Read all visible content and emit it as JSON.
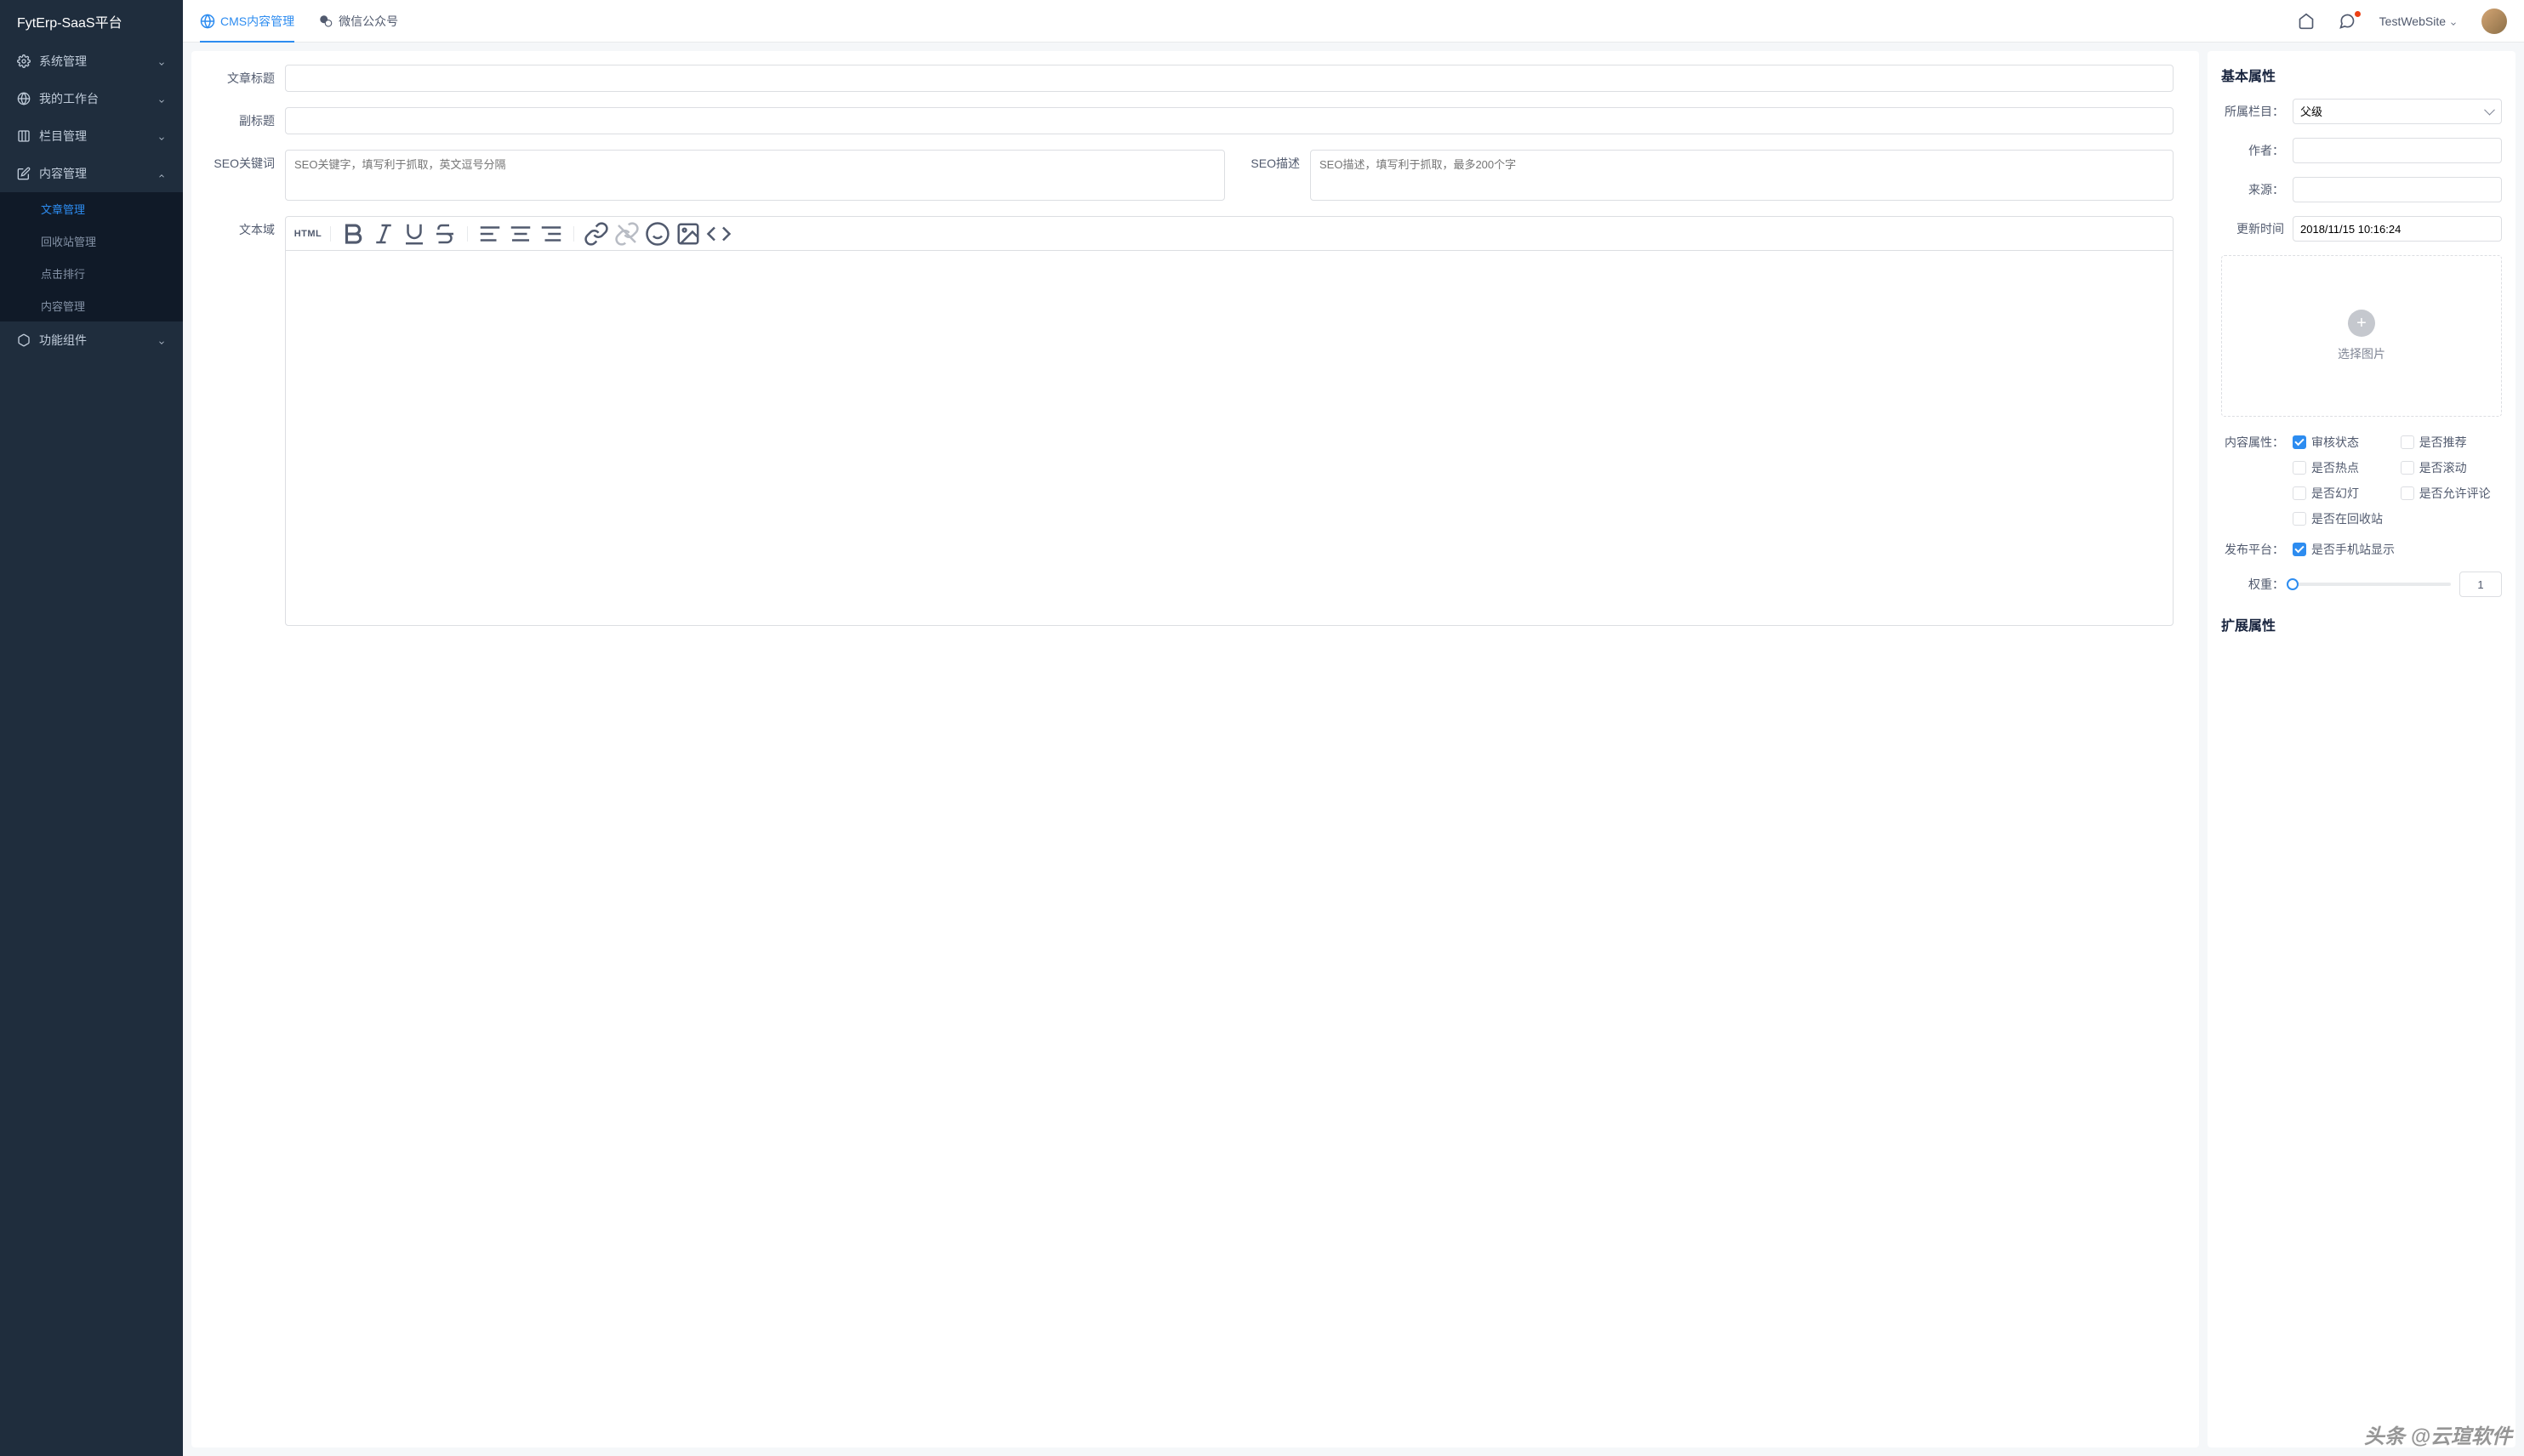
{
  "app": {
    "title": "FytErp-SaaS平台"
  },
  "sidebar": {
    "items": [
      {
        "label": "系统管理",
        "icon": "gear"
      },
      {
        "label": "我的工作台",
        "icon": "globe"
      },
      {
        "label": "栏目管理",
        "icon": "columns"
      },
      {
        "label": "内容管理",
        "icon": "edit",
        "expanded": true,
        "children": [
          {
            "label": "文章管理",
            "active": true
          },
          {
            "label": "回收站管理"
          },
          {
            "label": "点击排行"
          },
          {
            "label": "内容管理"
          }
        ]
      },
      {
        "label": "功能组件",
        "icon": "cube"
      }
    ]
  },
  "tabs": [
    {
      "label": "CMS内容管理",
      "icon": "globe",
      "active": true
    },
    {
      "label": "微信公众号",
      "icon": "wechat"
    }
  ],
  "header": {
    "site_name": "TestWebSite"
  },
  "form": {
    "title_label": "文章标题",
    "subtitle_label": "副标题",
    "seo_kw_label": "SEO关键词",
    "seo_kw_placeholder": "SEO关键字，填写利于抓取，英文逗号分隔",
    "seo_desc_label": "SEO描述",
    "seo_desc_placeholder": "SEO描述，填写利于抓取，最多200个字",
    "body_label": "文本域",
    "editor_html_label": "HTML"
  },
  "props": {
    "section_basic": "基本属性",
    "column_label": "所属栏目：",
    "column_value": "父级",
    "author_label": "作者：",
    "source_label": "来源：",
    "update_label": "更新时间",
    "update_value": "2018/11/15 10:16:24",
    "upload_label": "选择图片",
    "content_attr_label": "内容属性：",
    "checks": [
      {
        "label": "审核状态",
        "checked": true
      },
      {
        "label": "是否推荐",
        "checked": false
      },
      {
        "label": "是否热点",
        "checked": false
      },
      {
        "label": "是否滚动",
        "checked": false
      },
      {
        "label": "是否幻灯",
        "checked": false
      },
      {
        "label": "是否允许评论",
        "checked": false
      },
      {
        "label": "是否在回收站",
        "checked": false
      }
    ],
    "platform_label": "发布平台：",
    "platform_check": {
      "label": "是否手机站显示",
      "checked": true
    },
    "weight_label": "权重：",
    "weight_value": "1",
    "section_ext": "扩展属性"
  },
  "watermark": "头条 @云瑄软件"
}
